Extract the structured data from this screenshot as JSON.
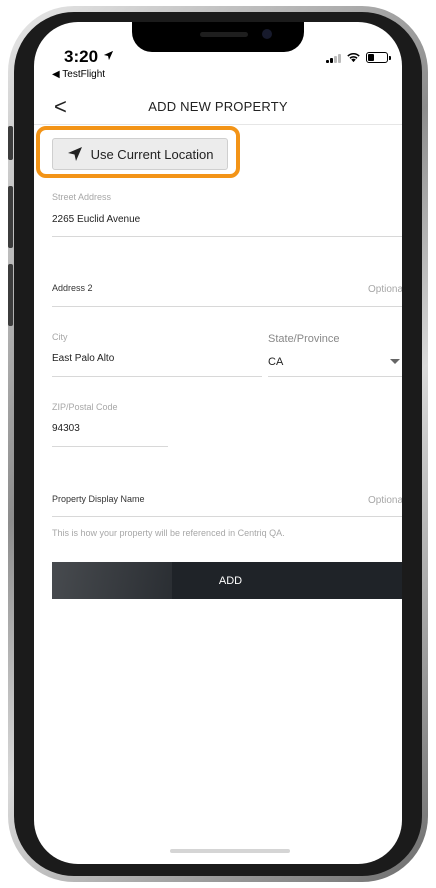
{
  "status_bar": {
    "time": "3:20",
    "back_app": "◀ TestFlight"
  },
  "nav": {
    "back_glyph": "<",
    "title": "ADD NEW PROPERTY"
  },
  "location_button": {
    "label": "Use Current Location",
    "icon": "navigation-arrow-icon",
    "highlight_color": "#f39417"
  },
  "form": {
    "street": {
      "label": "Street Address",
      "value": "2265 Euclid Avenue"
    },
    "address2": {
      "label": "Address 2",
      "hint": "Optional"
    },
    "city": {
      "label": "City",
      "value": "East Palo Alto"
    },
    "state": {
      "label": "State/Province",
      "value": "CA"
    },
    "zip": {
      "label": "ZIP/Postal Code",
      "value": "94303"
    },
    "display_name": {
      "label": "Property Display Name",
      "hint": "Optional",
      "helper": "This is how your property will be referenced in Centriq QA."
    }
  },
  "actions": {
    "add_label": "ADD",
    "add_color": "#1f2328"
  }
}
